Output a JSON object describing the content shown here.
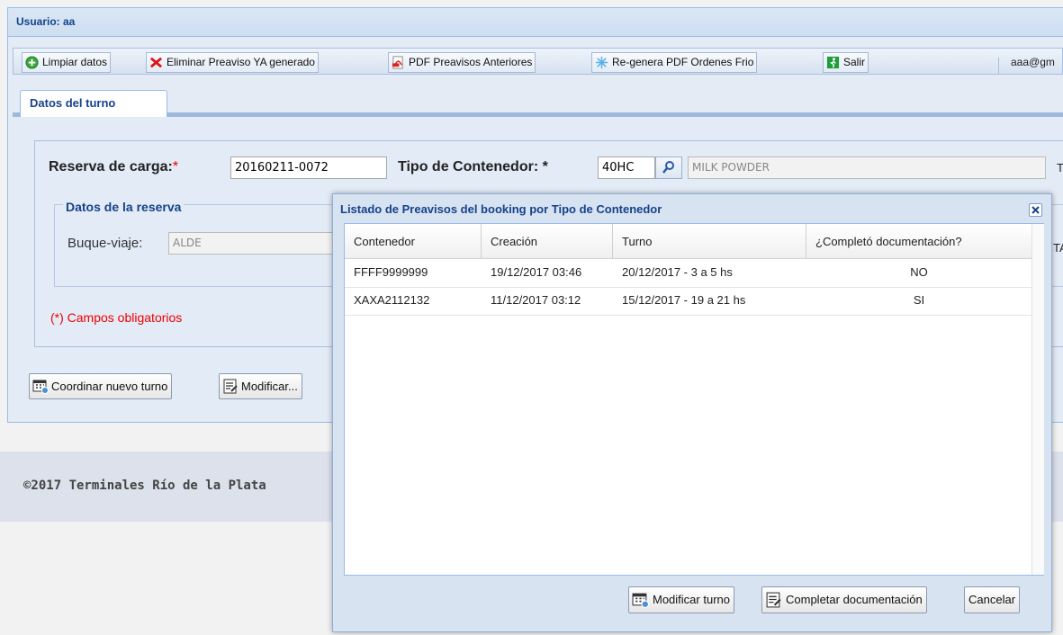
{
  "header": {
    "title": "Usuario: aa",
    "user_email": "aaa@gm"
  },
  "toolbar": {
    "clear_label": "Limpiar datos",
    "delete_label": "Eliminar Preaviso YA generado",
    "pdf_label": "PDF Preavisos Anteriores",
    "regen_label": "Re-genera PDF Ordenes Frio",
    "exit_label": "Salir"
  },
  "tabs": [
    {
      "label": "Datos del turno"
    }
  ],
  "form": {
    "reserva_label": "Reserva de carga:",
    "reserva_value": "20160211-0072",
    "tipo_label": "Tipo de Contenedor: *",
    "tipo_value": "40HC",
    "tipo_desc": "MILK POWDER",
    "trailing_char": "T",
    "trailing_char2": "TA",
    "reserva_legend": "Datos de la reserva",
    "buque_label": "Buque-viaje:",
    "buque_value": "ALDE",
    "required_note": "(*) Campos obligatorios",
    "required_mark": "*"
  },
  "actions": {
    "coordinate_label": "Coordinar nuevo turno",
    "modify_label": "Modificar..."
  },
  "footer": {
    "text": "©2017 Terminales Río de la Plata"
  },
  "dialog": {
    "title": "Listado de Preavisos del booking por Tipo de Contenedor",
    "columns": [
      "Contenedor",
      "Creación",
      "Turno",
      "¿Completó documentación?"
    ],
    "rows": [
      {
        "contenedor": "FFFF9999999",
        "creacion": "19/12/2017 03:46",
        "turno": "20/12/2017 - 3 a 5 hs",
        "completo": "NO"
      },
      {
        "contenedor": "XAXA2112132",
        "creacion": "11/12/2017 03:12",
        "turno": "15/12/2017 - 19 a 21 hs",
        "completo": "SI"
      }
    ],
    "modify_label": "Modificar turno",
    "complete_label": "Completar documentación",
    "cancel_label": "Cancelar"
  }
}
